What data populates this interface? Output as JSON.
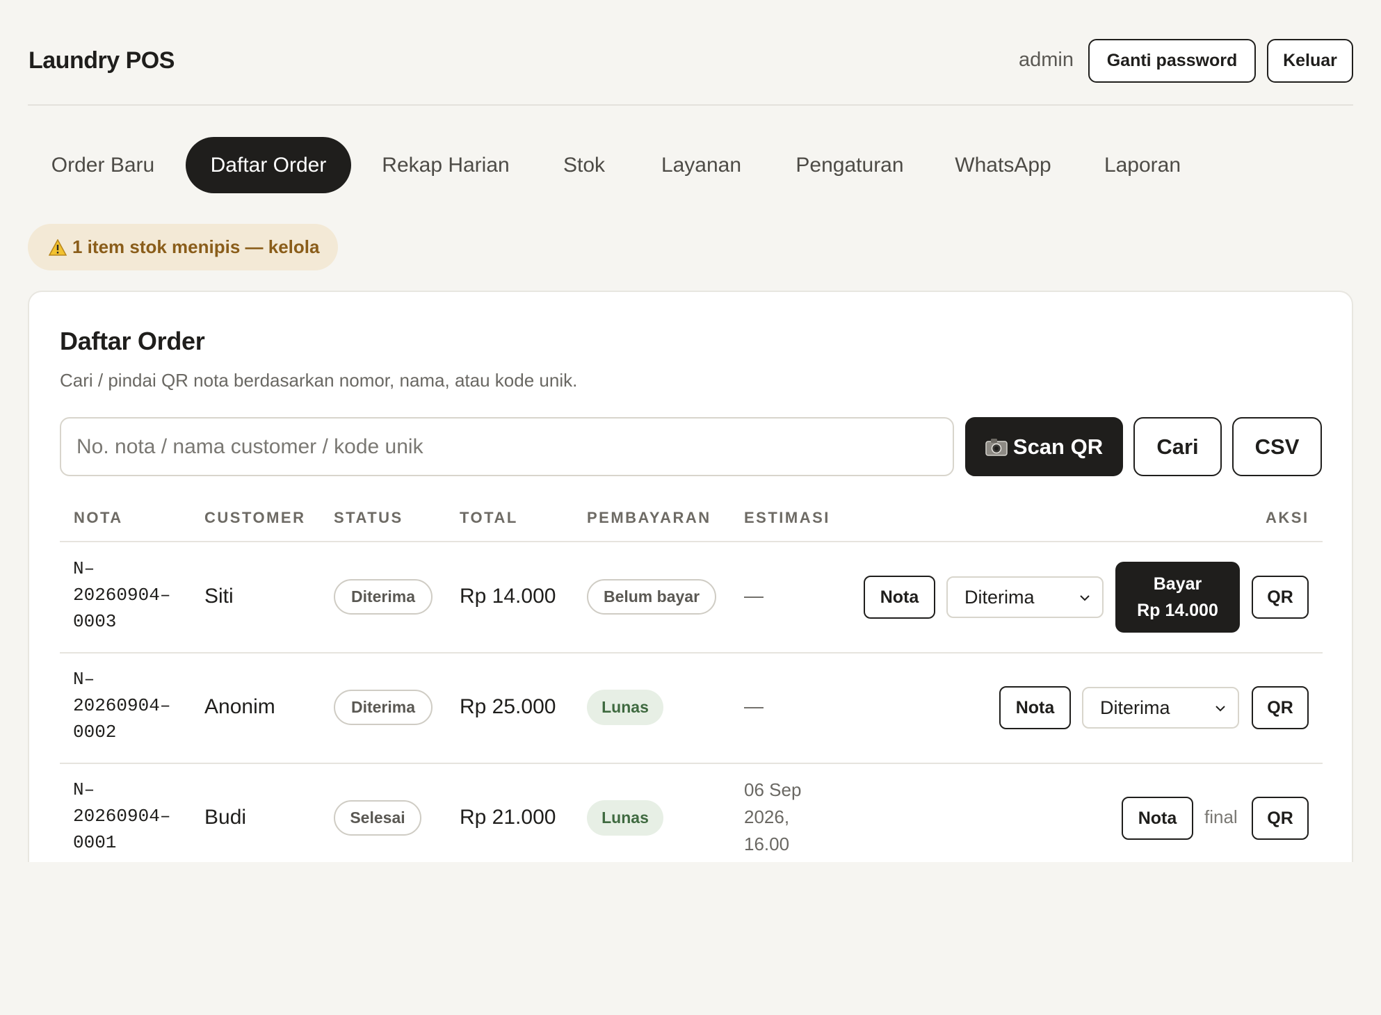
{
  "app": {
    "title": "Laundry POS",
    "user": "admin",
    "change_password": "Ganti password",
    "logout": "Keluar"
  },
  "tabs": [
    {
      "label": "Order Baru"
    },
    {
      "label": "Daftar Order",
      "active": true
    },
    {
      "label": "Rekap Harian"
    },
    {
      "label": "Stok"
    },
    {
      "label": "Layanan"
    },
    {
      "label": "Pengaturan"
    },
    {
      "label": "WhatsApp"
    },
    {
      "label": "Laporan"
    }
  ],
  "alert": {
    "icon": "warning-icon",
    "text": "1 item stok menipis — kelola"
  },
  "orders": {
    "title": "Daftar Order",
    "subtitle": "Cari / pindai QR nota berdasarkan nomor, nama, atau kode unik.",
    "search_placeholder": "No. nota / nama customer / kode unik",
    "scan_label": "Scan QR",
    "scan_icon": "camera-icon",
    "search_label": "Cari",
    "csv_label": "CSV",
    "columns": [
      "NOTA",
      "CUSTOMER",
      "STATUS",
      "TOTAL",
      "PEMBAYARAN",
      "ESTIMASI",
      "AKSI"
    ],
    "rows": [
      {
        "nota": "N–\n20260904–\n0003",
        "customer": "Siti",
        "status": "Diterima",
        "total": "Rp 14.000",
        "payment": "Belum bayar",
        "estimate": "—",
        "nota_btn": "Nota",
        "status_select": "Diterima",
        "pay_line1": "Bayar",
        "pay_line2": "Rp 14.000",
        "qr_btn": "QR"
      },
      {
        "nota": "N–\n20260904–\n0002",
        "customer": "Anonim",
        "status": "Diterima",
        "total": "Rp 25.000",
        "payment": "Lunas",
        "estimate": "—",
        "nota_btn": "Nota",
        "status_select": "Diterima",
        "qr_btn": "QR"
      },
      {
        "nota": "N–\n20260904–\n0001",
        "customer": "Budi",
        "status": "Selesai",
        "total": "Rp 21.000",
        "payment": "Lunas",
        "estimate": "06 Sep\n2026,\n16.00",
        "nota_btn": "Nota",
        "final_label": "final",
        "qr_btn": "QR"
      }
    ]
  }
}
